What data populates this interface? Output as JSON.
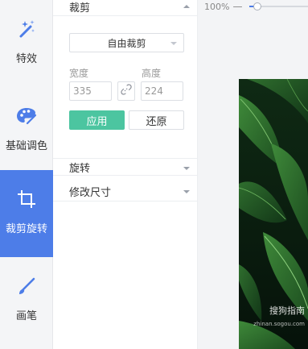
{
  "toolbar": {
    "items": [
      {
        "label": "特效",
        "icon": "magic-wand-icon",
        "active": false
      },
      {
        "label": "基础调色",
        "icon": "palette-icon",
        "active": false
      },
      {
        "label": "裁剪旋转",
        "icon": "crop-icon",
        "active": true
      },
      {
        "label": "画笔",
        "icon": "brush-icon",
        "active": false
      }
    ]
  },
  "panel": {
    "crop": {
      "title": "裁剪",
      "ratio_value": "自由裁剪",
      "width_label": "宽度",
      "width_value": "335",
      "height_label": "高度",
      "height_value": "224",
      "apply_label": "应用",
      "reset_label": "还原"
    },
    "rotate_title": "旋转",
    "resize_title": "修改尺寸"
  },
  "canvas": {
    "zoom_label": "100%",
    "zoom_minus": "—",
    "zoom_level": 0.13,
    "watermark_text": "搜狗指南",
    "watermark_url": "zhinan.sogou.com"
  },
  "colors": {
    "accent_blue": "#4d7de8",
    "apply_green": "#4cc5a0"
  }
}
